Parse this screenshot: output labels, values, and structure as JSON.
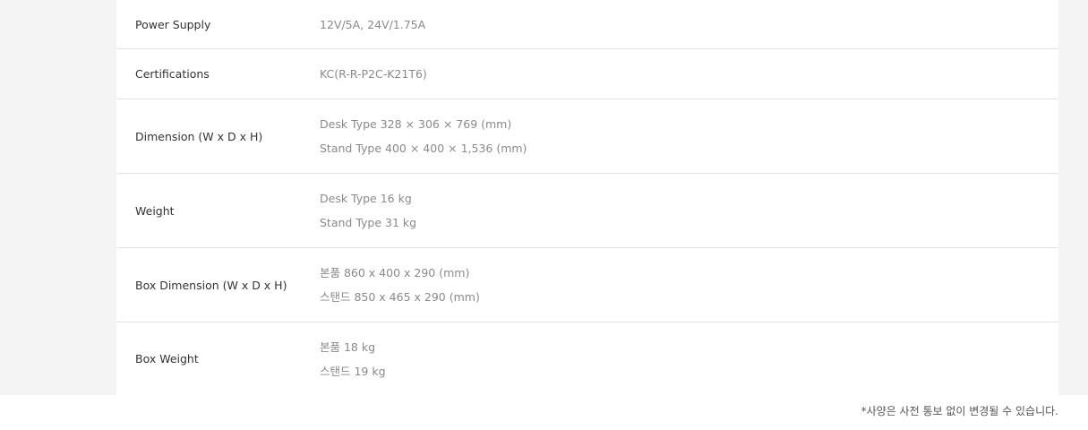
{
  "specs": [
    {
      "label": "Power Supply",
      "values": [
        "12V/5A, 24V/1.75A"
      ]
    },
    {
      "label": "Certifications",
      "values": [
        "KC(R-R-P2C-K21T6)"
      ]
    },
    {
      "label": "Dimension (W x D x H)",
      "values": [
        "Desk Type 328 × 306 × 769 (mm)",
        "Stand Type 400 × 400 × 1,536 (mm)"
      ]
    },
    {
      "label": "Weight",
      "values": [
        "Desk Type 16 kg",
        "Stand Type 31 kg"
      ]
    },
    {
      "label": "Box Dimension (W x D x H)",
      "values": [
        "본품 860 x 400 x 290 (mm)",
        "스탠드 850 x 465 x 290 (mm)"
      ]
    },
    {
      "label": "Box Weight",
      "values": [
        "본품 18 kg",
        "스탠드 19 kg"
      ]
    }
  ],
  "footnote": "*사양은 사전 통보 없이 변경될 수 있습니다."
}
